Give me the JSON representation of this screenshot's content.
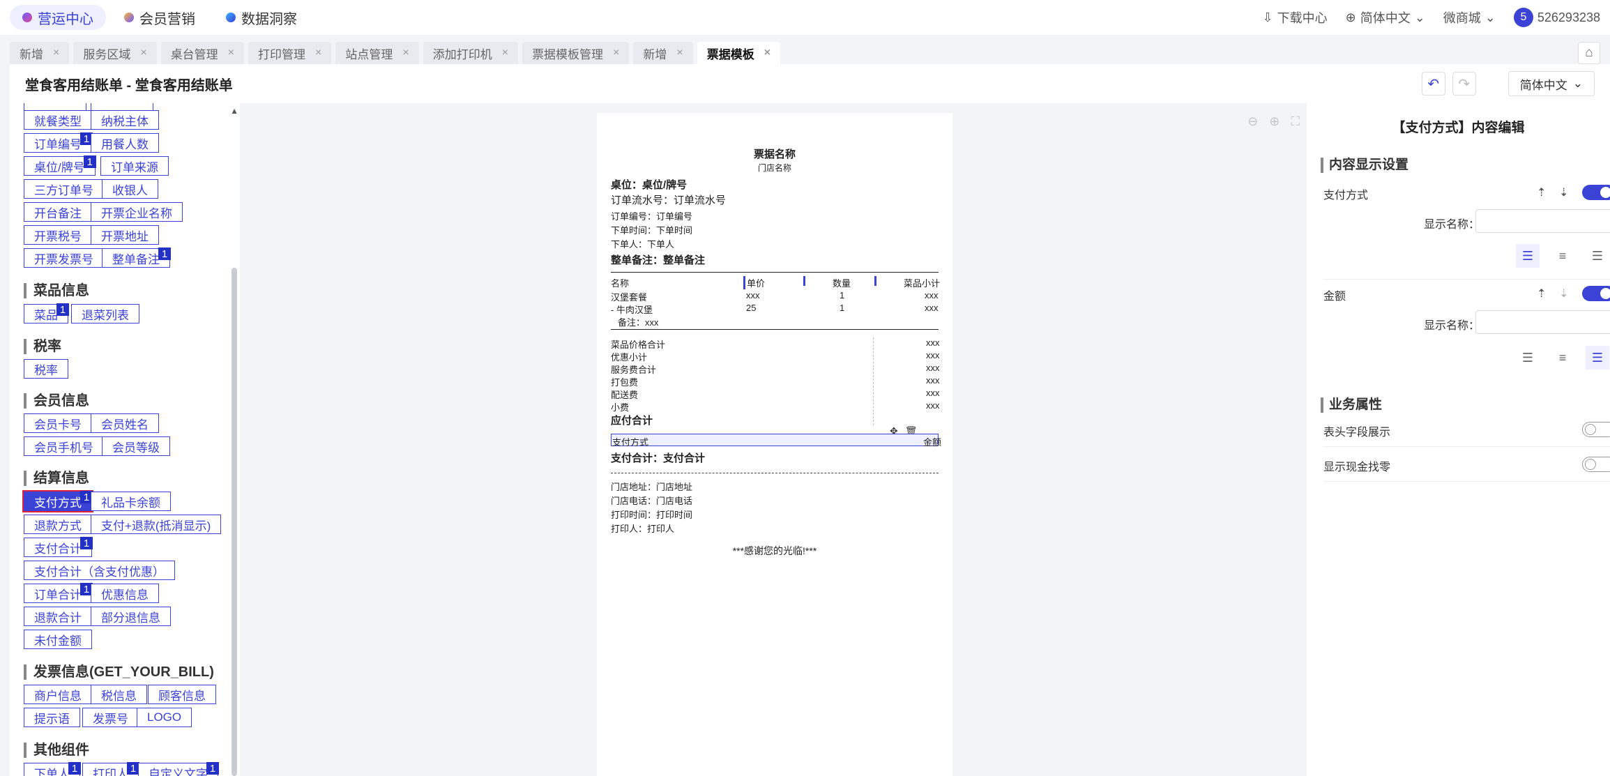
{
  "topbar": {
    "nav": [
      {
        "label": "营运中心",
        "active": true
      },
      {
        "label": "会员营销",
        "active": false
      },
      {
        "label": "数据洞察",
        "active": false
      }
    ],
    "download": "下载中心",
    "language": "简体中文",
    "store": "微商城",
    "avatar_initial": "5",
    "account": "526293238"
  },
  "tabs": [
    {
      "label": "新增",
      "active": false
    },
    {
      "label": "服务区域",
      "active": false
    },
    {
      "label": "桌台管理",
      "active": false
    },
    {
      "label": "打印管理",
      "active": false
    },
    {
      "label": "站点管理",
      "active": false
    },
    {
      "label": "添加打印机",
      "active": false
    },
    {
      "label": "票据模板管理",
      "active": false
    },
    {
      "label": "新增",
      "active": false
    },
    {
      "label": "票据模板",
      "active": true
    }
  ],
  "tab_close": "×",
  "header": {
    "title": "堂食客用结账单 - 堂食客用结账单",
    "language": "简体中文"
  },
  "left": {
    "sections": {
      "dishes": "菜品信息",
      "tax": "税率",
      "member": "会员信息",
      "settle": "结算信息",
      "invoice": "发票信息(GET_YOUR_BILL)",
      "other": "其他组件"
    },
    "chips": {
      "meal_type": "就餐类型",
      "tax_entity": "纳税主体",
      "order_no": "订单编号",
      "diners": "用餐人数",
      "table_no": "桌位/牌号",
      "order_source": "订单来源",
      "third_order": "三方订单号",
      "cashier": "收银人",
      "open_note": "开台备注",
      "invoice_company": "开票企业名称",
      "invoice_tax_no": "开票税号",
      "invoice_address": "开票地址",
      "invoice_no": "开票发票号",
      "order_note": "整单备注",
      "dish": "菜品",
      "refund_list": "退菜列表",
      "tax_rate": "税率",
      "member_card": "会员卡号",
      "member_name": "会员姓名",
      "member_phone": "会员手机号",
      "member_level": "会员等级",
      "pay_method": "支付方式",
      "gift_balance": "礼品卡余额",
      "refund_method": "退款方式",
      "pay_refund": "支付+退款(抵消显示)",
      "pay_total": "支付合计",
      "pay_total_disc": "支付合计（含支付优惠）",
      "order_total": "订单合计",
      "discount_info": "优惠信息",
      "refund_total": "退款合计",
      "partial_refund": "部分退信息",
      "unpaid": "未付金额",
      "merchant": "商户信息",
      "tax_info": "税信息",
      "customer_info": "顾客信息",
      "tip_text": "提示语",
      "invoice_number": "发票号",
      "logo": "LOGO",
      "ordered_by": "下单人",
      "printer_person": "打印人",
      "custom_text": "自定义文字"
    },
    "badge": "1"
  },
  "receipt": {
    "title": "票据名称",
    "store": "门店名称",
    "table": "桌位：桌位/牌号",
    "serial": "订单流水号：订单流水号",
    "order_no": "订单编号：订单编号",
    "order_time": "下单时间：下单时间",
    "ordered_by": "下单人：下单人",
    "order_note": "整单备注：整单备注",
    "cols": [
      "名称",
      "单价",
      "数量",
      "菜品小计"
    ],
    "rows": [
      {
        "name": "汉堡套餐",
        "price": "xxx",
        "qty": "1",
        "sub": "xxx"
      },
      {
        "name": "- 牛肉汉堡",
        "price": "25",
        "qty": "1",
        "sub": "xxx"
      }
    ],
    "row_note": "备注：xxx",
    "summary": [
      {
        "label": "菜品价格合计",
        "value": "xxx"
      },
      {
        "label": "优惠小计",
        "value": "xxx"
      },
      {
        "label": "服务费合计",
        "value": "xxx"
      },
      {
        "label": "打包费",
        "value": "xxx"
      },
      {
        "label": "配送费",
        "value": "xxx"
      },
      {
        "label": "小费",
        "value": "xxx"
      }
    ],
    "order_total": "应付合计",
    "pay_method": "支付方式",
    "pay_amount": "金额",
    "pay_total": "支付合计：支付合计",
    "address": "门店地址：门店地址",
    "phone": "门店电话：门店电话",
    "print_time": "打印时间：打印时间",
    "printer": "打印人：打印人",
    "thanks": "***感谢您的光临!***"
  },
  "right": {
    "title": "【支付方式】内容编辑",
    "display_settings": "内容显示设置",
    "field1": "支付方式",
    "field2": "金额",
    "display_name": "显示名称：",
    "business": "业务属性",
    "header_field": "表头字段展示",
    "cash_change": "显示现金找零"
  },
  "colors": {
    "accent": "#3b42d6",
    "selected_outline": "#e0203a"
  }
}
